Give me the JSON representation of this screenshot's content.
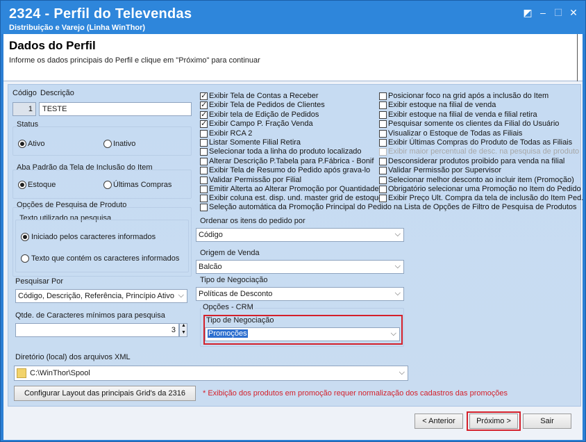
{
  "window": {
    "title": "2324 - Perfil do Televendas",
    "subtitle": "Distribuição e Varejo (Linha WinThor)",
    "controls": {
      "restore": "◩",
      "minimize": "–",
      "maximize": "☐",
      "close": "✕"
    }
  },
  "header": {
    "title": "Dados do Perfil",
    "instruction": "Informe os dados principais do Perfil e clique em \"Próximo\" para continuar"
  },
  "form": {
    "codigo_label": "Código",
    "descricao_label": "Descrição",
    "codigo_value": "1",
    "descricao_value": "TESTE",
    "status": {
      "label": "Status",
      "options": [
        "Ativo",
        "Inativo"
      ],
      "selected": "Ativo"
    },
    "aba_padrao": {
      "label": "Aba Padrão da Tela de Inclusão do Item",
      "options": [
        "Estoque",
        "Últimas Compras"
      ],
      "selected": "Estoque"
    },
    "opcoes_pesquisa": {
      "label": "Opções de Pesquisa de Produto",
      "group_label": "Texto utilizado na pesquisa",
      "options": [
        "Iniciado pelos caracteres informados",
        "Texto que contém os caracteres informados"
      ],
      "selected": "Iniciado pelos caracteres informados"
    },
    "pesquisar_por": {
      "label": "Pesquisar Por",
      "value": "Código, Descrição, Referência, Princípio Ativo"
    },
    "qtde_caracteres": {
      "label": "Qtde. de Caracteres mínimos para pesquisa",
      "value": "3"
    },
    "diretorio": {
      "label": "Diretório (local) dos arquivos XML",
      "value": "C:\\WinThor\\Spool"
    },
    "configurar_button": "Configurar Layout das principais Grid's da 2316",
    "promo_note": "* Exibição dos produtos em promoção requer normalização dos cadastros das promoções"
  },
  "checks_col1": [
    {
      "label": "Exibir Tela de Contas a Receber",
      "checked": true
    },
    {
      "label": "Exibir Tela de Pedidos de Clientes",
      "checked": true
    },
    {
      "label": "Exibir tela de Edição de Pedidos",
      "checked": true
    },
    {
      "label": "Exibir Campo P. Fração Venda",
      "checked": true
    },
    {
      "label": "Exibir RCA 2",
      "checked": false
    },
    {
      "label": "Listar Somente Filial Retira",
      "checked": false
    },
    {
      "label": "Selecionar toda a linha do produto localizado",
      "checked": false
    },
    {
      "label": "Alterar Descrição P.Tabela para P.Fábrica - Bonif",
      "checked": false
    },
    {
      "label": "Exibir Tela de Resumo do Pedido após grava-lo",
      "checked": false
    },
    {
      "label": "Validar Permissão por Filial",
      "checked": false
    },
    {
      "label": "Emitir Alterta ao Alterar Promoção por Quantidade",
      "checked": false
    },
    {
      "label": "Exibir coluna est. disp. und. master grid de estoque",
      "checked": false
    }
  ],
  "checks_col2": [
    {
      "label": "Posicionar foco na grid após a inclusão do Item",
      "checked": false,
      "disabled": false
    },
    {
      "label": "Exibir estoque na filial de venda",
      "checked": false,
      "disabled": false
    },
    {
      "label": "Exibir estoque na filial de venda e filial retira",
      "checked": false,
      "disabled": false
    },
    {
      "label": "Pesquisar somente os clientes da Filial do Usuário",
      "checked": false,
      "disabled": false
    },
    {
      "label": "Visualizar o Estoque de Todas as Filiais",
      "checked": false,
      "disabled": false
    },
    {
      "label": "Exibir Últimas Compras do Produto de Todas as Filiais",
      "checked": false,
      "disabled": false
    },
    {
      "label": "Exibir maior percentual de desc. na pesquisa de produto",
      "checked": false,
      "disabled": true
    },
    {
      "label": "Desconsiderar produtos proibido para venda na filial",
      "checked": false,
      "disabled": false
    },
    {
      "label": "Validar Permissão por Supervisor",
      "checked": false,
      "disabled": false
    },
    {
      "label": "Selecionar melhor desconto ao incluir item (Promoção)",
      "checked": false,
      "disabled": false
    },
    {
      "label": "Obrigatório selecionar uma Promoção no Item do Pedido",
      "checked": false,
      "disabled": false
    },
    {
      "label": "Exibir Preço Ult. Compra da tela de inclusão do Item Ped.",
      "checked": false,
      "disabled": false
    }
  ],
  "check_wide": {
    "label": "Seleção automática da Promoção Principal do Pedido na Lista de Opções de Filtro de Pesquisa de Produtos",
    "checked": false
  },
  "ordenar": {
    "label": "Ordenar os itens do pedido por",
    "value": "Código"
  },
  "origem": {
    "label": "Origem de Venda",
    "value": "Balcão"
  },
  "tipo_negociacao": {
    "label": "Tipo de Negociação",
    "value": "Políticas de Desconto"
  },
  "crm": {
    "group_label": "Opções - CRM",
    "tipo_label": "Tipo de Negociação",
    "tipo_value": "Promoções"
  },
  "footer": {
    "anterior": "< Anterior",
    "proximo": "Próximo >",
    "sair": "Sair"
  }
}
